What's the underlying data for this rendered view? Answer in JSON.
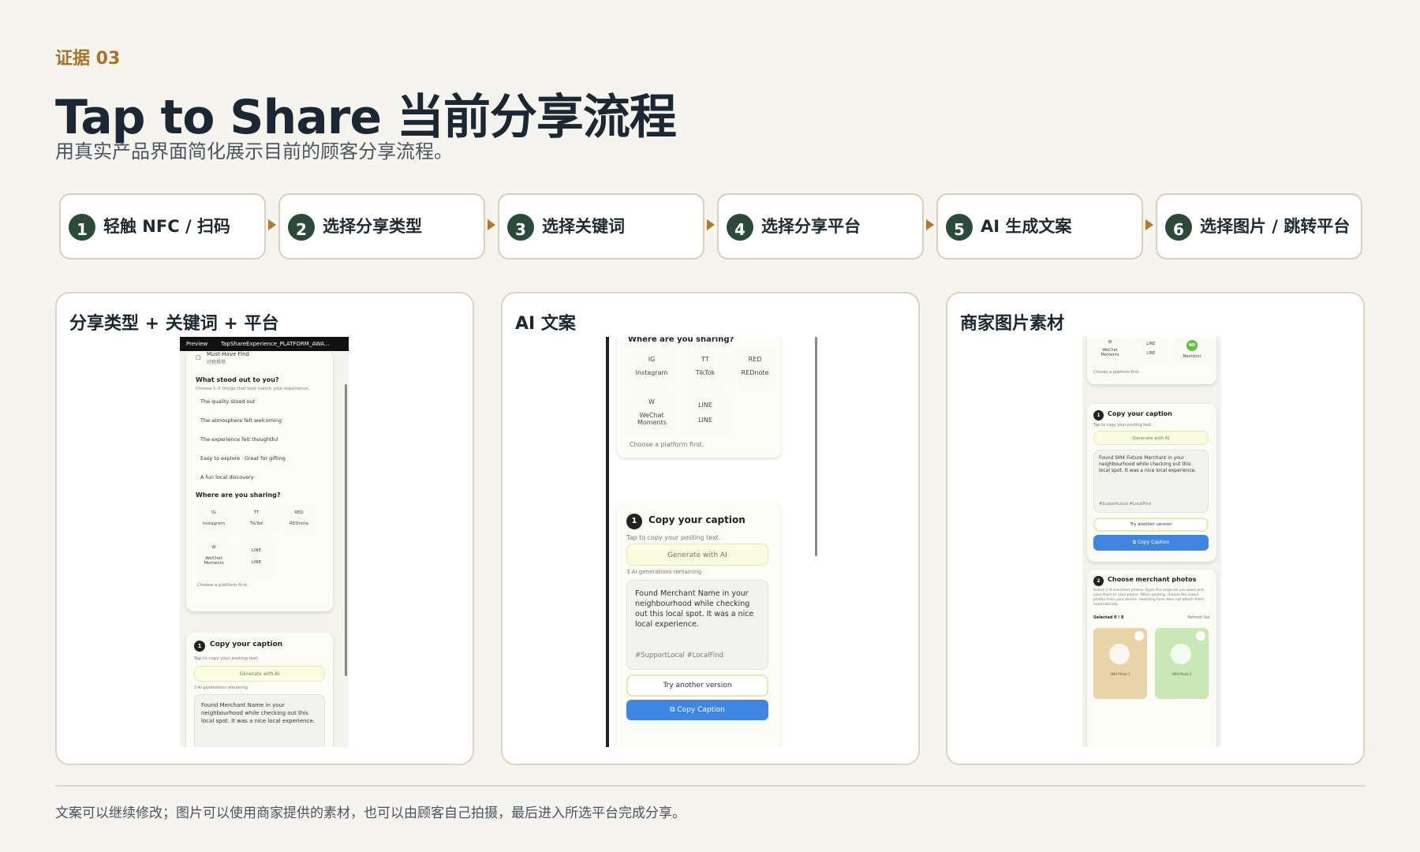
{
  "header": {
    "eyebrow": "证据 03",
    "title": "Tap to Share 当前分享流程",
    "subtitle": "用真实产品界面简化展示目前的顾客分享流程。"
  },
  "steps": [
    {
      "num": "1",
      "label": "轻触 NFC / 扫码"
    },
    {
      "num": "2",
      "label": "选择分享类型"
    },
    {
      "num": "3",
      "label": "选择关键词"
    },
    {
      "num": "4",
      "label": "选择分享平台"
    },
    {
      "num": "5",
      "label": "AI 生成文案"
    },
    {
      "num": "6",
      "label": "选择图片 / 跳转平台"
    }
  ],
  "panels": {
    "p1": {
      "title": "分享类型 + 关键词 + 平台",
      "bar_preview": "Preview",
      "bar_file": "TapShareExperience_PLATFORM_AWA...",
      "must_have": "Must-Have Find",
      "must_have_sub": "好物推荐",
      "stood_out": "What stood out to you?",
      "stood_out_sub": "Choose 1–3 things that best match your experience.",
      "keywords": [
        "The quality stood out",
        "The atmosphere felt welcoming",
        "The experience felt thoughtful",
        "Easy to explore",
        "Great for gifting",
        "A fun local discovery"
      ],
      "sharing": "Where are you sharing?",
      "platforms": [
        {
          "code": "IG",
          "name": "Instagram"
        },
        {
          "code": "TT",
          "name": "TikTok"
        },
        {
          "code": "RED",
          "name": "REDnote"
        },
        {
          "code": "W",
          "name": "WeChat Moments"
        },
        {
          "code": "LINE",
          "name": "LINE"
        }
      ],
      "choose_first": "Choose a platform first.",
      "copy_title": "Copy your caption",
      "copy_sub": "Tap to copy your posting text.",
      "generate": "Generate with AI",
      "remaining": "3 AI generations remaining",
      "caption": "Found Merchant Name in your neighbourhood while checking out this local spot. It was a nice local experience."
    },
    "p2": {
      "title": "AI 文案",
      "sharing": "Where are you sharing?",
      "platforms": [
        {
          "code": "IG",
          "name": "Instagram"
        },
        {
          "code": "TT",
          "name": "TikTok"
        },
        {
          "code": "RED",
          "name": "REDnote"
        },
        {
          "code": "W",
          "name": "WeChat Moments"
        },
        {
          "code": "LINE",
          "name": "LINE"
        }
      ],
      "choose_first": "Choose a platform first.",
      "copy_title": "Copy your caption",
      "copy_sub": "Tap to copy your posting text.",
      "generate": "Generate with AI",
      "remaining": "3 AI generations remaining",
      "caption": "Found Merchant Name in your neighbourhood while checking out this local spot. It was a nice local experience.",
      "tags": "#SupportLocal #LocalFind",
      "try_another": "Try another version",
      "copy_button": "Copy Caption"
    },
    "p3": {
      "title": "商家图片素材",
      "platforms": [
        {
          "code": "W",
          "name": "WeChat Moments"
        },
        {
          "code": "LINE",
          "name": "LINE"
        },
        {
          "code": "ND",
          "name": "Nextdoor"
        }
      ],
      "choose_first": "Choose a platform first.",
      "copy_title": "Copy your caption",
      "copy_sub": "Tap to copy your posting text.",
      "generate": "Generate with AI",
      "caption": "Found SM4 Fixture Merchant in your neighbourhood while checking out this local spot. It was a nice local experience.",
      "tags": "#SupportLocal #LocalFind",
      "try_another": "Try another version",
      "copy_button": "Copy Caption",
      "photos_title": "Choose merchant photos",
      "photos_desc": "Select 1–8 merchant photos. Open the originals you want and save them to your phone. When posting, choose the saved photos from your device. Selecting here does not attach them automatically.",
      "selected": "Selected 0 / 8",
      "refresh": "Refresh Set",
      "photo1": "SM4 Photo 1",
      "photo2": "SM4 Photo 2"
    }
  },
  "footer": "文案可以继续修改；图片可以使用商家提供的素材，也可以由顾客自己拍摄，最后进入所选平台完成分享。",
  "colors": {
    "accent": "#a8732a",
    "step_badge": "#2b4a3a",
    "copy_blue": "#3f86e0",
    "gen_yellow": "#fbfde1",
    "nextdoor_green": "#5cc23a"
  }
}
